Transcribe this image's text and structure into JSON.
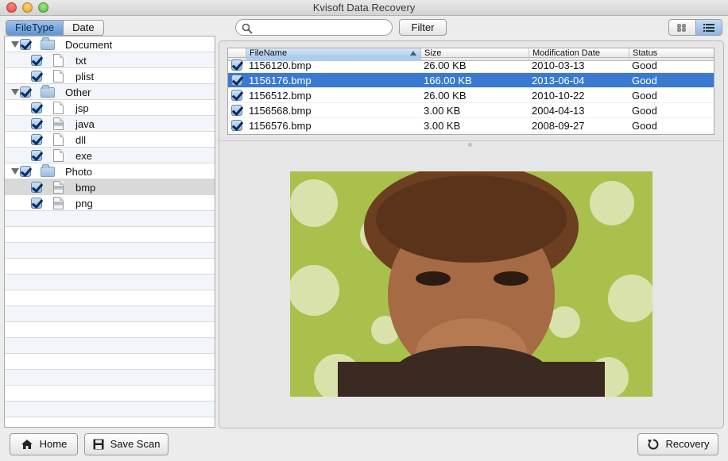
{
  "window": {
    "title": "Kvisoft Data Recovery"
  },
  "tabs": [
    {
      "label": "FileType",
      "active": true
    },
    {
      "label": "Date",
      "active": false
    }
  ],
  "search": {
    "value": "",
    "placeholder": ""
  },
  "filter_label": "Filter",
  "view_toggle": {
    "options": [
      "grid-icon",
      "list-icon"
    ],
    "active": "list-icon"
  },
  "tree": [
    {
      "label": "Document",
      "level": 0,
      "kind": "folder"
    },
    {
      "label": "txt",
      "level": 1,
      "kind": "file"
    },
    {
      "label": "plist",
      "level": 1,
      "kind": "file"
    },
    {
      "label": "Other",
      "level": 0,
      "kind": "folder"
    },
    {
      "label": "jsp",
      "level": 1,
      "kind": "file"
    },
    {
      "label": "java",
      "level": 1,
      "kind": "file"
    },
    {
      "label": "dll",
      "level": 1,
      "kind": "file"
    },
    {
      "label": "exe",
      "level": 1,
      "kind": "file"
    },
    {
      "label": "Photo",
      "level": 0,
      "kind": "folder"
    },
    {
      "label": "bmp",
      "level": 1,
      "kind": "image",
      "selected": true
    },
    {
      "label": "png",
      "level": 1,
      "kind": "image"
    }
  ],
  "table": {
    "columns": [
      "FileName",
      "Size",
      "Modification Date",
      "Status"
    ],
    "rows": [
      {
        "name": "1156120.bmp",
        "size": "26.00 KB",
        "date": "2010-03-13",
        "status": "Good",
        "checked": true
      },
      {
        "name": "1156176.bmp",
        "size": "166.00 KB",
        "date": "2013-06-04",
        "status": "Good",
        "checked": true,
        "selected": true
      },
      {
        "name": "1156512.bmp",
        "size": "26.00 KB",
        "date": "2010-10-22",
        "status": "Good",
        "checked": true
      },
      {
        "name": "1156568.bmp",
        "size": "3.00 KB",
        "date": "2004-04-13",
        "status": "Good",
        "checked": true
      },
      {
        "name": "1156576.bmp",
        "size": "3.00 KB",
        "date": "2008-09-27",
        "status": "Good",
        "checked": true
      }
    ]
  },
  "preview": {
    "description_icon": "photo-preview"
  },
  "buttons": {
    "home": "Home",
    "save_scan": "Save Scan",
    "recovery": "Recovery"
  },
  "colors": {
    "selection": "#3a79d0",
    "accent": "#5e95d6"
  }
}
